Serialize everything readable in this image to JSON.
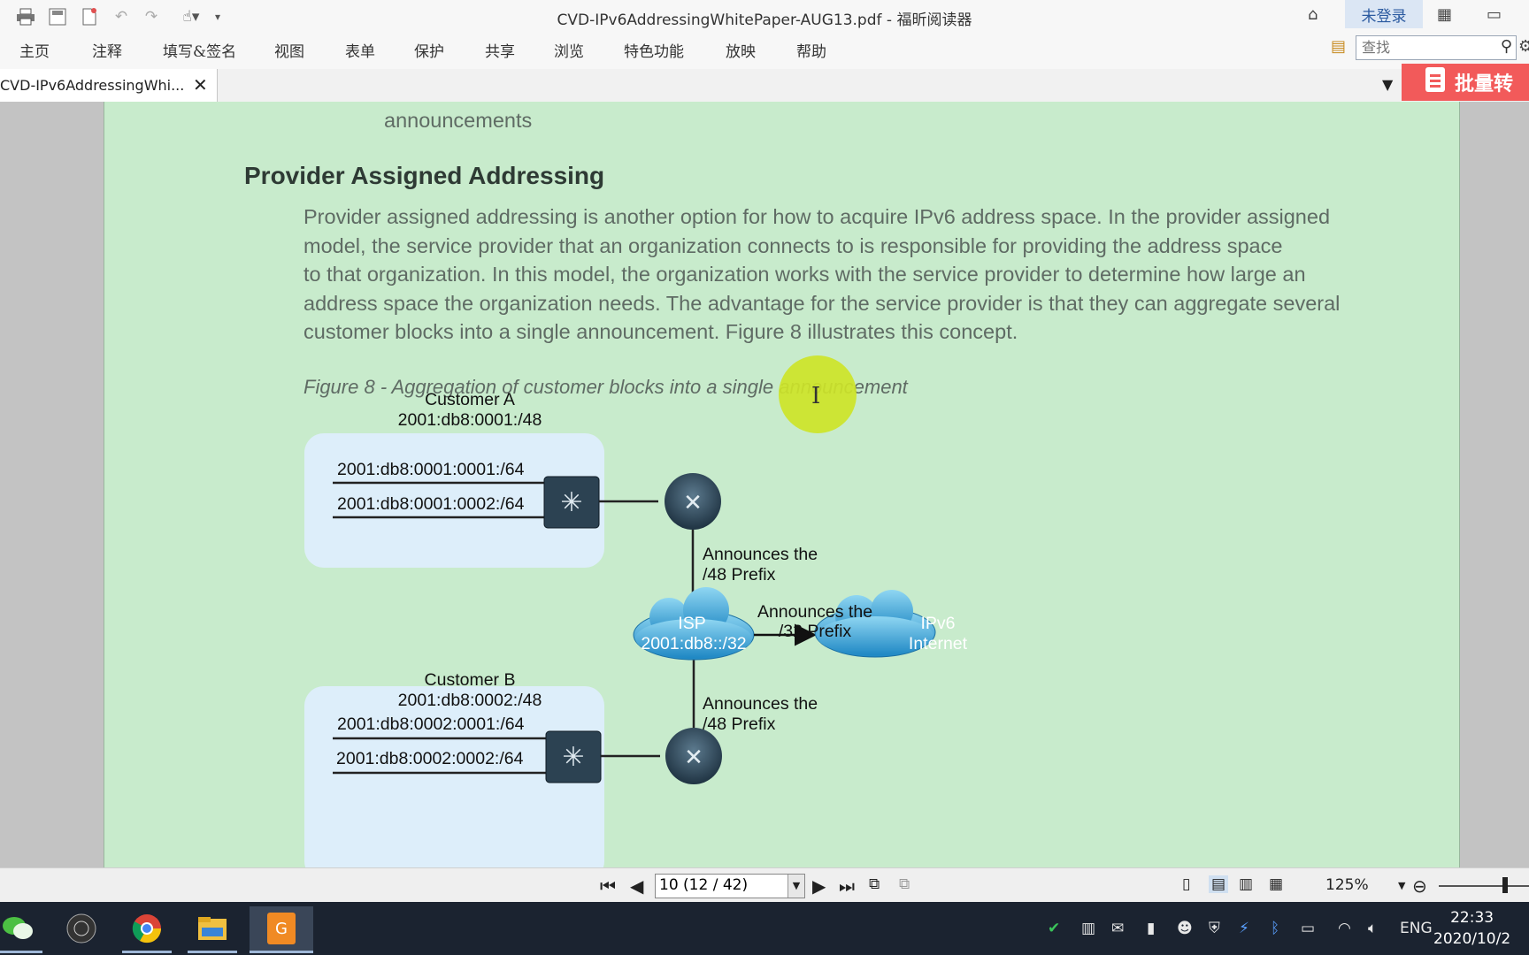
{
  "window": {
    "title": "CVD-IPv6AddressingWhitePaper-AUG13.pdf - 福昕阅读器",
    "login_label": "未登录"
  },
  "menu": [
    "主页",
    "注释",
    "填写&签名",
    "视图",
    "表单",
    "保护",
    "共享",
    "浏览",
    "特色功能",
    "放映",
    "帮助"
  ],
  "search": {
    "placeholder": "查找"
  },
  "tab": {
    "label": "CVD-IPv6AddressingWhi...",
    "close": "✕"
  },
  "banner": {
    "label": "批量转"
  },
  "document": {
    "prev_line": "announcements",
    "heading": "Provider Assigned Addressing",
    "paragraph_lines": [
      "Provider assigned addressing is another option for how to acquire IPv6 address space. In the provider assigned",
      "model, the service provider that an organization connects to is responsible for providing the address space",
      "to that organization. In this model, the organization works with the service provider to determine how large an",
      "address space the organization needs. The advantage for the service provider is that they can aggregate several",
      "customer blocks into a single announcement. Figure 8 illustrates this concept."
    ],
    "caption": "Figure 8 - Aggregation of customer blocks into a single announcement"
  },
  "diagram": {
    "customer_a": {
      "name": "Customer A",
      "prefix": "2001:db8:0001:/48",
      "subnets": [
        "2001:db8:0001:0001:/64",
        "2001:db8:0001:0002:/64"
      ]
    },
    "customer_b": {
      "name": "Customer B",
      "prefix": "2001:db8:0002:/48",
      "subnets": [
        "2001:db8:0002:0001:/64",
        "2001:db8:0002:0002:/64"
      ]
    },
    "isp": {
      "name": "ISP",
      "prefix": "2001:db8::/32"
    },
    "internet": {
      "line1": "IPv6",
      "line2": "Internet"
    },
    "announce_48_top": [
      "Announces the",
      "/48 Prefix"
    ],
    "announce_32": [
      "Announces the",
      "/32 Prefix"
    ],
    "announce_48_bottom": [
      "Announces the",
      "/48 Prefix"
    ]
  },
  "status": {
    "page_value": "10 (12 / 42)",
    "zoom": "125%"
  },
  "taskbar": {
    "lang": "ENG",
    "time": "22:33",
    "date": "2020/10/2"
  },
  "colors": {
    "page_background": "#c8ebcc",
    "banner": "#f25a5a",
    "cursor_highlight": "#cde428"
  }
}
